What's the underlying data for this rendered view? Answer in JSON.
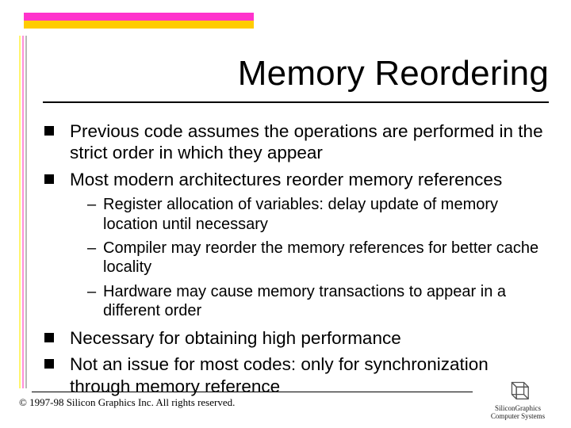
{
  "title": "Memory Reordering",
  "bullets": [
    {
      "text": "Previous code assumes the operations are performed in the strict order in which they appear"
    },
    {
      "text": "Most modern architectures reorder memory references",
      "sub": [
        "Register allocation of variables: delay update of memory location until necessary",
        "Compiler may reorder the memory references for better cache locality",
        "Hardware may cause memory transactions to appear in a different order"
      ]
    },
    {
      "text": "Necessary for obtaining high performance"
    },
    {
      "text": "Not an issue for most codes: only for synchronization through memory reference"
    }
  ],
  "footer": "© 1997-98 Silicon Graphics Inc. All rights reserved.",
  "logo": {
    "line1": "SiliconGraphics",
    "line2": "Computer Systems"
  }
}
